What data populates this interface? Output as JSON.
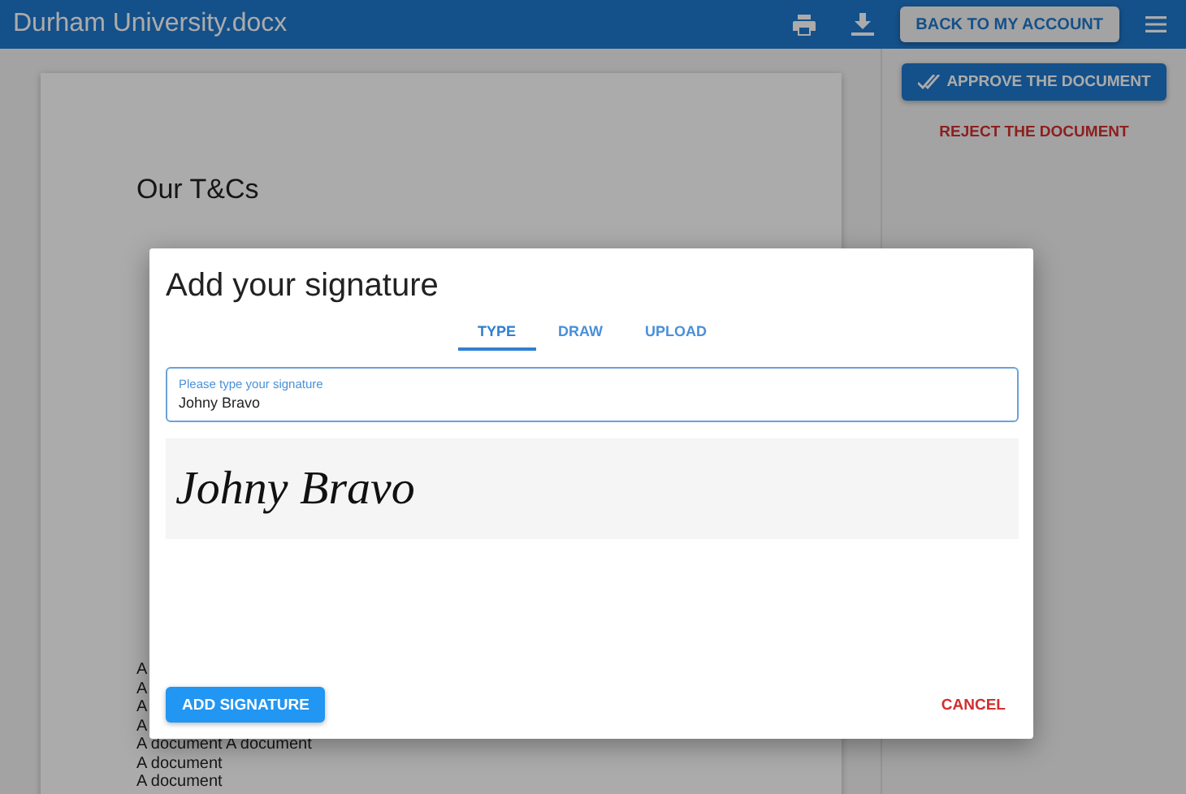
{
  "header": {
    "title": "Durham University.docx",
    "account_button": "BACK TO MY ACCOUNT"
  },
  "sidebar": {
    "approve_button": "APPROVE THE DOCUMENT",
    "reject_link": "REJECT THE DOCUMENT"
  },
  "document": {
    "heading": "Our T&Cs",
    "lines": [
      "A",
      "A",
      "A",
      "A",
      "A document A document",
      "A document",
      "A document"
    ]
  },
  "dialog": {
    "title": "Add your signature",
    "tabs": [
      {
        "label": "TYPE",
        "selected": true
      },
      {
        "label": "DRAW",
        "selected": false
      },
      {
        "label": "UPLOAD",
        "selected": false
      }
    ],
    "field": {
      "label": "Please type your signature",
      "value": "Johny Bravo"
    },
    "preview": "Johny Bravo",
    "primary_button": "ADD SIGNATURE",
    "cancel_button": "CANCEL"
  }
}
